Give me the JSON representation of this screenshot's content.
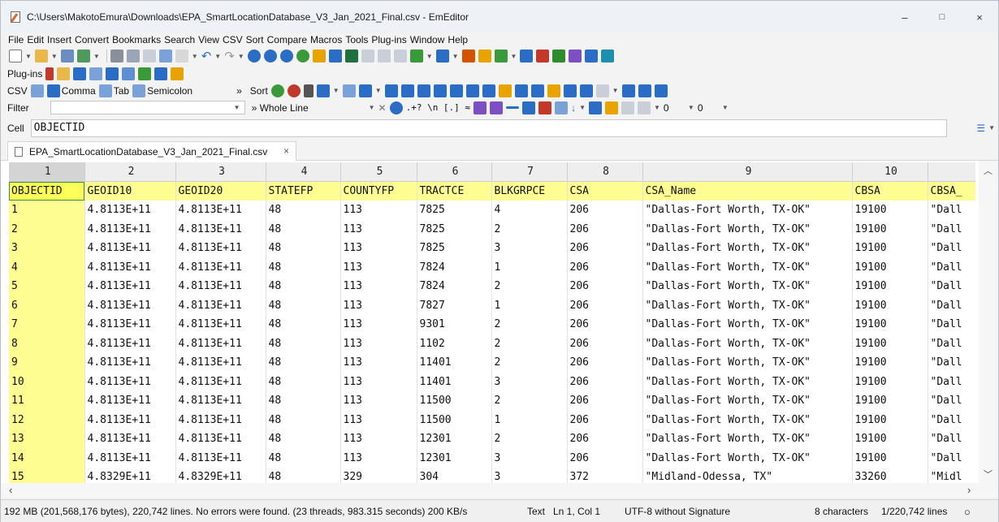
{
  "window": {
    "title": "C:\\Users\\MakotoEmura\\Downloads\\EPA_SmartLocationDatabase_V3_Jan_2021_Final.csv - EmEditor",
    "minimize": "–",
    "maximize": "□",
    "close": "×"
  },
  "menu": [
    "File",
    "Edit",
    "Insert",
    "Convert",
    "Bookmarks",
    "Search",
    "View",
    "CSV",
    "Sort",
    "Compare",
    "Macros",
    "Tools",
    "Plug-ins",
    "Window",
    "Help"
  ],
  "toolbar": {
    "plugins_label": "Plug-ins",
    "csv_label": "CSV",
    "comma": "Comma",
    "tab": "Tab",
    "semicolon": "Semicolon",
    "overflow": "»",
    "sort_label": "Sort",
    "filter_label": "Filter",
    "whole_line": "» Whole Line",
    "filter_opts": ".+? \\n [.] ≈",
    "num1": "0",
    "num2": "0",
    "icon_colors": [
      "#2b6cc4",
      "#e8a300",
      "#3a9a3a",
      "#c0392b",
      "#7d4fc4",
      "#1f8fb0",
      "#d35400",
      "#16a085"
    ]
  },
  "cellbar": {
    "label": "Cell",
    "value": "OBJECTID"
  },
  "tab": {
    "label": "EPA_SmartLocationDatabase_V3_Jan_2021_Final.csv",
    "close": "×"
  },
  "grid": {
    "col_numbers": [
      "1",
      "2",
      "3",
      "4",
      "5",
      "6",
      "7",
      "8",
      "9",
      "10",
      ""
    ],
    "headers": [
      "OBJECTID",
      "GEOID10",
      "GEOID20",
      "STATEFP",
      "COUNTYFP",
      "TRACTCE",
      "BLKGRPCE",
      "CSA",
      "CSA_Name",
      "CBSA",
      "CBSA_"
    ],
    "rows": [
      [
        "1",
        "4.8113E+11",
        "4.8113E+11",
        "48",
        "113",
        "7825",
        "4",
        "206",
        "\"Dallas-Fort Worth, TX-OK\"",
        "19100",
        "\"Dall"
      ],
      [
        "2",
        "4.8113E+11",
        "4.8113E+11",
        "48",
        "113",
        "7825",
        "2",
        "206",
        "\"Dallas-Fort Worth, TX-OK\"",
        "19100",
        "\"Dall"
      ],
      [
        "3",
        "4.8113E+11",
        "4.8113E+11",
        "48",
        "113",
        "7825",
        "3",
        "206",
        "\"Dallas-Fort Worth, TX-OK\"",
        "19100",
        "\"Dall"
      ],
      [
        "4",
        "4.8113E+11",
        "4.8113E+11",
        "48",
        "113",
        "7824",
        "1",
        "206",
        "\"Dallas-Fort Worth, TX-OK\"",
        "19100",
        "\"Dall"
      ],
      [
        "5",
        "4.8113E+11",
        "4.8113E+11",
        "48",
        "113",
        "7824",
        "2",
        "206",
        "\"Dallas-Fort Worth, TX-OK\"",
        "19100",
        "\"Dall"
      ],
      [
        "6",
        "4.8113E+11",
        "4.8113E+11",
        "48",
        "113",
        "7827",
        "1",
        "206",
        "\"Dallas-Fort Worth, TX-OK\"",
        "19100",
        "\"Dall"
      ],
      [
        "7",
        "4.8113E+11",
        "4.8113E+11",
        "48",
        "113",
        "9301",
        "2",
        "206",
        "\"Dallas-Fort Worth, TX-OK\"",
        "19100",
        "\"Dall"
      ],
      [
        "8",
        "4.8113E+11",
        "4.8113E+11",
        "48",
        "113",
        "1102",
        "2",
        "206",
        "\"Dallas-Fort Worth, TX-OK\"",
        "19100",
        "\"Dall"
      ],
      [
        "9",
        "4.8113E+11",
        "4.8113E+11",
        "48",
        "113",
        "11401",
        "2",
        "206",
        "\"Dallas-Fort Worth, TX-OK\"",
        "19100",
        "\"Dall"
      ],
      [
        "10",
        "4.8113E+11",
        "4.8113E+11",
        "48",
        "113",
        "11401",
        "3",
        "206",
        "\"Dallas-Fort Worth, TX-OK\"",
        "19100",
        "\"Dall"
      ],
      [
        "11",
        "4.8113E+11",
        "4.8113E+11",
        "48",
        "113",
        "11500",
        "2",
        "206",
        "\"Dallas-Fort Worth, TX-OK\"",
        "19100",
        "\"Dall"
      ],
      [
        "12",
        "4.8113E+11",
        "4.8113E+11",
        "48",
        "113",
        "11500",
        "1",
        "206",
        "\"Dallas-Fort Worth, TX-OK\"",
        "19100",
        "\"Dall"
      ],
      [
        "13",
        "4.8113E+11",
        "4.8113E+11",
        "48",
        "113",
        "12301",
        "2",
        "206",
        "\"Dallas-Fort Worth, TX-OK\"",
        "19100",
        "\"Dall"
      ],
      [
        "14",
        "4.8113E+11",
        "4.8113E+11",
        "48",
        "113",
        "12301",
        "3",
        "206",
        "\"Dallas-Fort Worth, TX-OK\"",
        "19100",
        "\"Dall"
      ],
      [
        "15",
        "4.8329E+11",
        "4.8329E+11",
        "48",
        "329",
        "304",
        "3",
        "372",
        "\"Midland-Odessa, TX\"",
        "33260",
        "\"Midl"
      ]
    ]
  },
  "status": {
    "summary": "192 MB (201,568,176 bytes), 220,742 lines. No errors were found. (23 threads, 983.315 seconds) 200 KB/s",
    "mode": "Text",
    "position": "Ln 1, Col 1",
    "encoding": "UTF-8 without Signature",
    "chars": "8 characters",
    "lines": "1/220,742 lines"
  }
}
